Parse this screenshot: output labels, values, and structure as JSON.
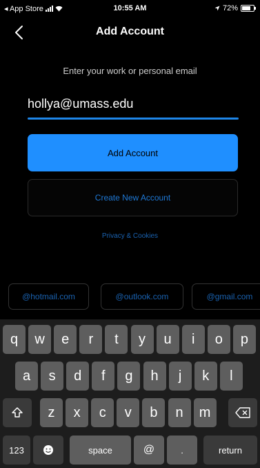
{
  "status_bar": {
    "back_app": "◂ App Store",
    "time": "10:55 AM",
    "battery": "72%",
    "battery_level": 0.72
  },
  "nav": {
    "back_icon": "chevron-left-icon",
    "title": "Add Account"
  },
  "form": {
    "prompt": "Enter your work or personal email",
    "email_value": "hollya@umass.edu",
    "add_button": "Add Account",
    "create_button": "Create New Account",
    "privacy_link": "Privacy & Cookies"
  },
  "suggestions": [
    "@hotmail.com",
    "@outlook.com",
    "@gmail.com"
  ],
  "keyboard": {
    "row1": [
      "q",
      "w",
      "e",
      "r",
      "t",
      "y",
      "u",
      "i",
      "o",
      "p"
    ],
    "row2": [
      "a",
      "s",
      "d",
      "f",
      "g",
      "h",
      "j",
      "k",
      "l"
    ],
    "row3": [
      "z",
      "x",
      "c",
      "v",
      "b",
      "n",
      "m"
    ],
    "numbers_key": "123",
    "space_key": "space",
    "at_key": "@",
    "period_key": ".",
    "return_key": "return",
    "shift_icon": "shift-icon",
    "delete_icon": "delete-icon",
    "emoji_icon": "emoji-icon"
  },
  "colors": {
    "accent": "#1f8fff",
    "background": "#000000",
    "link": "#1a62b0"
  }
}
